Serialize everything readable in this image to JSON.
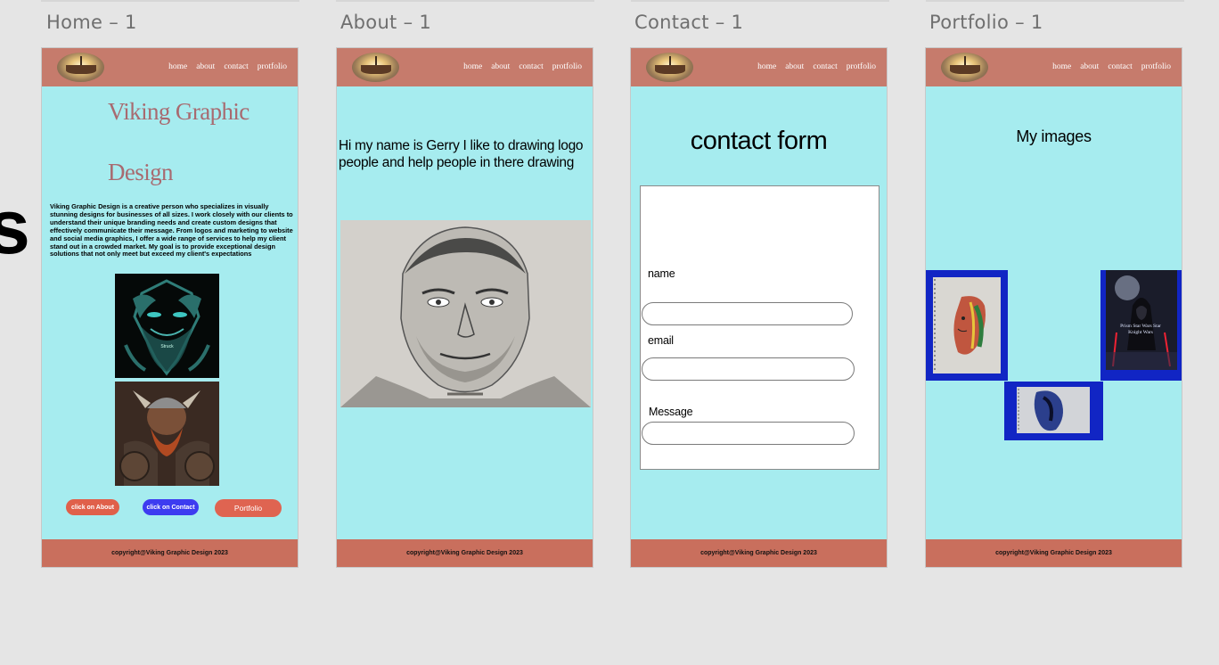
{
  "frames": {
    "home": {
      "label": "Home – 1"
    },
    "about": {
      "label": "About – 1"
    },
    "contact": {
      "label": "Contact – 1"
    },
    "portfolio": {
      "label": "Portfolio – 1"
    }
  },
  "canvas": {
    "partial_heading": "s"
  },
  "nav": [
    "home",
    "about",
    "contact",
    "protfolio"
  ],
  "footer": "copyright@Viking Graphic Design 2023",
  "home": {
    "title_line1": "Viking Graphic",
    "title_line2": "Design",
    "paragraph": "Viking Graphic Design is a creative person who specializes in visually stunning designs for businesses of all sizes. I work closely with our clients to understand their unique branding needs and create custom designs that effectively communicate their message. From logos and marketing to website  and social media graphics, I offer a wide range of services to help my client stand  out in a crowded market. My goal is to provide exceptional design solutions that not only meet but exceed my client's expectations",
    "art1_caption": "Struck",
    "buttons": {
      "about": "click on About",
      "contact": "click on Contact",
      "portfolio": "Portfolio"
    }
  },
  "about": {
    "intro": "Hi my name is Gerry I like to drawing logo people and help people in there drawing"
  },
  "contact": {
    "title": "contact form",
    "name_label": "name",
    "email_label": "email",
    "message_label": "Message",
    "name_value": "",
    "email_value": "",
    "message_value": ""
  },
  "portfolio": {
    "title": "My images",
    "starwars_caption": "Prism Star Wars Star Knight Wars"
  },
  "colors": {
    "canvas": "#e5e5e5",
    "page_bg": "#a6ecef",
    "header": "#c67b6c",
    "footer": "#c96f5d",
    "title": "#a86a70",
    "btn_about": "#e0604a",
    "btn_contact": "#3d3cf0",
    "btn_portfolio": "#df6451",
    "image_frame": "#1125c4"
  }
}
